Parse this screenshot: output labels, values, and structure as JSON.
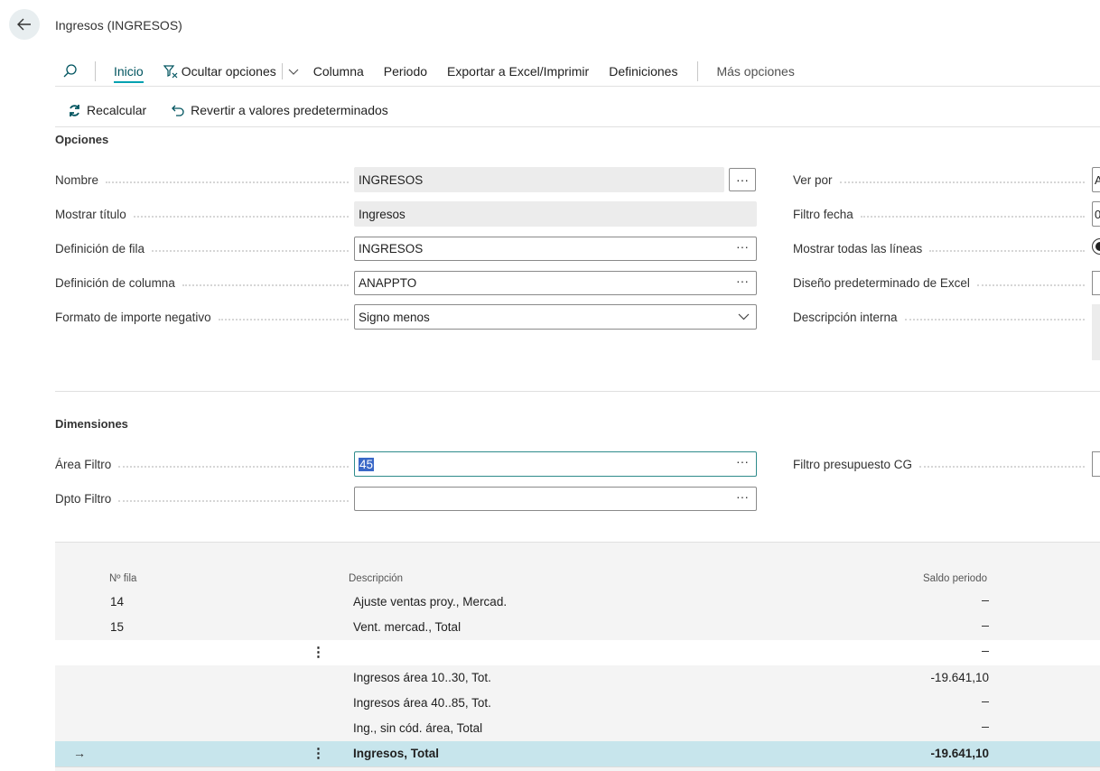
{
  "page": {
    "title": "Ingresos (INGRESOS)"
  },
  "actions": {
    "home": "Inicio",
    "hide_options": "Ocultar opciones",
    "column": "Columna",
    "period": "Periodo",
    "export": "Exportar a Excel/Imprimir",
    "definitions": "Definiciones",
    "more": "Más opciones"
  },
  "subactions": {
    "recalc": "Recalcular",
    "revert": "Revertir a valores predeterminados"
  },
  "options": {
    "title": "Opciones",
    "name_label": "Nombre",
    "name_value": "INGRESOS",
    "show_title_label": "Mostrar título",
    "show_title_value": "Ingresos",
    "row_def_label": "Definición de fila",
    "row_def_value": "INGRESOS",
    "col_def_label": "Definición de columna",
    "col_def_value": "ANAPPTO",
    "neg_format_label": "Formato de importe negativo",
    "neg_format_value": "Signo menos",
    "view_by_label": "Ver por",
    "view_by_value": "A",
    "date_filter_label": "Filtro fecha",
    "date_filter_value": "0",
    "show_all_label": "Mostrar todas las líneas",
    "excel_layout_label": "Diseño predeterminado de Excel",
    "internal_desc_label": "Descripción interna"
  },
  "dimensions": {
    "title": "Dimensiones",
    "area_label": "Área Filtro",
    "area_value": "45",
    "dept_label": "Dpto Filtro",
    "dept_value": "",
    "budget_label": "Filtro presupuesto CG"
  },
  "grid": {
    "headers": {
      "row_no": "Nº fila",
      "description": "Descripción",
      "balance": "Saldo periodo"
    },
    "rows": [
      {
        "no": "14",
        "desc": "Ajuste ventas proy., Mercad.",
        "value": ""
      },
      {
        "no": "15",
        "desc": "Vent. mercad., Total",
        "value": ""
      },
      {
        "no": "",
        "desc": "",
        "value": ""
      },
      {
        "no": "",
        "desc": "Ingresos área 10..30, Tot.",
        "value": "-19.641,10"
      },
      {
        "no": "",
        "desc": "Ingresos área 40..85, Tot.",
        "value": ""
      },
      {
        "no": "",
        "desc": "Ing., sin cód. área, Total",
        "value": ""
      },
      {
        "no": "",
        "desc": "Ingresos, Total",
        "value": "-19.641,10"
      }
    ]
  },
  "colors": {
    "accent": "#00a1b1",
    "selected_row": "#c7e5ec",
    "selection": "#3a68c7"
  }
}
